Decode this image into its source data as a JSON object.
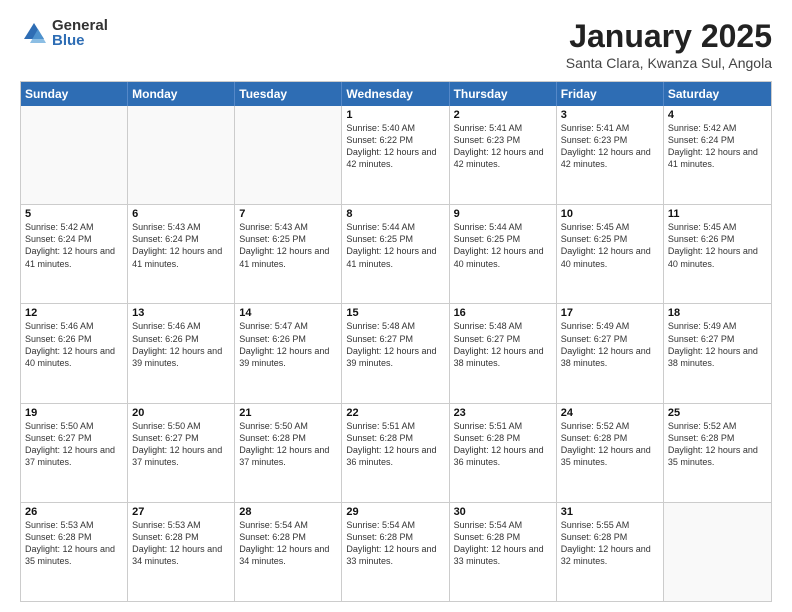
{
  "logo": {
    "general": "General",
    "blue": "Blue"
  },
  "header": {
    "month": "January 2025",
    "location": "Santa Clara, Kwanza Sul, Angola"
  },
  "days": [
    "Sunday",
    "Monday",
    "Tuesday",
    "Wednesday",
    "Thursday",
    "Friday",
    "Saturday"
  ],
  "rows": [
    [
      {
        "day": "",
        "info": ""
      },
      {
        "day": "",
        "info": ""
      },
      {
        "day": "",
        "info": ""
      },
      {
        "day": "1",
        "info": "Sunrise: 5:40 AM\nSunset: 6:22 PM\nDaylight: 12 hours and 42 minutes."
      },
      {
        "day": "2",
        "info": "Sunrise: 5:41 AM\nSunset: 6:23 PM\nDaylight: 12 hours and 42 minutes."
      },
      {
        "day": "3",
        "info": "Sunrise: 5:41 AM\nSunset: 6:23 PM\nDaylight: 12 hours and 42 minutes."
      },
      {
        "day": "4",
        "info": "Sunrise: 5:42 AM\nSunset: 6:24 PM\nDaylight: 12 hours and 41 minutes."
      }
    ],
    [
      {
        "day": "5",
        "info": "Sunrise: 5:42 AM\nSunset: 6:24 PM\nDaylight: 12 hours and 41 minutes."
      },
      {
        "day": "6",
        "info": "Sunrise: 5:43 AM\nSunset: 6:24 PM\nDaylight: 12 hours and 41 minutes."
      },
      {
        "day": "7",
        "info": "Sunrise: 5:43 AM\nSunset: 6:25 PM\nDaylight: 12 hours and 41 minutes."
      },
      {
        "day": "8",
        "info": "Sunrise: 5:44 AM\nSunset: 6:25 PM\nDaylight: 12 hours and 41 minutes."
      },
      {
        "day": "9",
        "info": "Sunrise: 5:44 AM\nSunset: 6:25 PM\nDaylight: 12 hours and 40 minutes."
      },
      {
        "day": "10",
        "info": "Sunrise: 5:45 AM\nSunset: 6:25 PM\nDaylight: 12 hours and 40 minutes."
      },
      {
        "day": "11",
        "info": "Sunrise: 5:45 AM\nSunset: 6:26 PM\nDaylight: 12 hours and 40 minutes."
      }
    ],
    [
      {
        "day": "12",
        "info": "Sunrise: 5:46 AM\nSunset: 6:26 PM\nDaylight: 12 hours and 40 minutes."
      },
      {
        "day": "13",
        "info": "Sunrise: 5:46 AM\nSunset: 6:26 PM\nDaylight: 12 hours and 39 minutes."
      },
      {
        "day": "14",
        "info": "Sunrise: 5:47 AM\nSunset: 6:26 PM\nDaylight: 12 hours and 39 minutes."
      },
      {
        "day": "15",
        "info": "Sunrise: 5:48 AM\nSunset: 6:27 PM\nDaylight: 12 hours and 39 minutes."
      },
      {
        "day": "16",
        "info": "Sunrise: 5:48 AM\nSunset: 6:27 PM\nDaylight: 12 hours and 38 minutes."
      },
      {
        "day": "17",
        "info": "Sunrise: 5:49 AM\nSunset: 6:27 PM\nDaylight: 12 hours and 38 minutes."
      },
      {
        "day": "18",
        "info": "Sunrise: 5:49 AM\nSunset: 6:27 PM\nDaylight: 12 hours and 38 minutes."
      }
    ],
    [
      {
        "day": "19",
        "info": "Sunrise: 5:50 AM\nSunset: 6:27 PM\nDaylight: 12 hours and 37 minutes."
      },
      {
        "day": "20",
        "info": "Sunrise: 5:50 AM\nSunset: 6:27 PM\nDaylight: 12 hours and 37 minutes."
      },
      {
        "day": "21",
        "info": "Sunrise: 5:50 AM\nSunset: 6:28 PM\nDaylight: 12 hours and 37 minutes."
      },
      {
        "day": "22",
        "info": "Sunrise: 5:51 AM\nSunset: 6:28 PM\nDaylight: 12 hours and 36 minutes."
      },
      {
        "day": "23",
        "info": "Sunrise: 5:51 AM\nSunset: 6:28 PM\nDaylight: 12 hours and 36 minutes."
      },
      {
        "day": "24",
        "info": "Sunrise: 5:52 AM\nSunset: 6:28 PM\nDaylight: 12 hours and 35 minutes."
      },
      {
        "day": "25",
        "info": "Sunrise: 5:52 AM\nSunset: 6:28 PM\nDaylight: 12 hours and 35 minutes."
      }
    ],
    [
      {
        "day": "26",
        "info": "Sunrise: 5:53 AM\nSunset: 6:28 PM\nDaylight: 12 hours and 35 minutes."
      },
      {
        "day": "27",
        "info": "Sunrise: 5:53 AM\nSunset: 6:28 PM\nDaylight: 12 hours and 34 minutes."
      },
      {
        "day": "28",
        "info": "Sunrise: 5:54 AM\nSunset: 6:28 PM\nDaylight: 12 hours and 34 minutes."
      },
      {
        "day": "29",
        "info": "Sunrise: 5:54 AM\nSunset: 6:28 PM\nDaylight: 12 hours and 33 minutes."
      },
      {
        "day": "30",
        "info": "Sunrise: 5:54 AM\nSunset: 6:28 PM\nDaylight: 12 hours and 33 minutes."
      },
      {
        "day": "31",
        "info": "Sunrise: 5:55 AM\nSunset: 6:28 PM\nDaylight: 12 hours and 32 minutes."
      },
      {
        "day": "",
        "info": ""
      }
    ]
  ]
}
